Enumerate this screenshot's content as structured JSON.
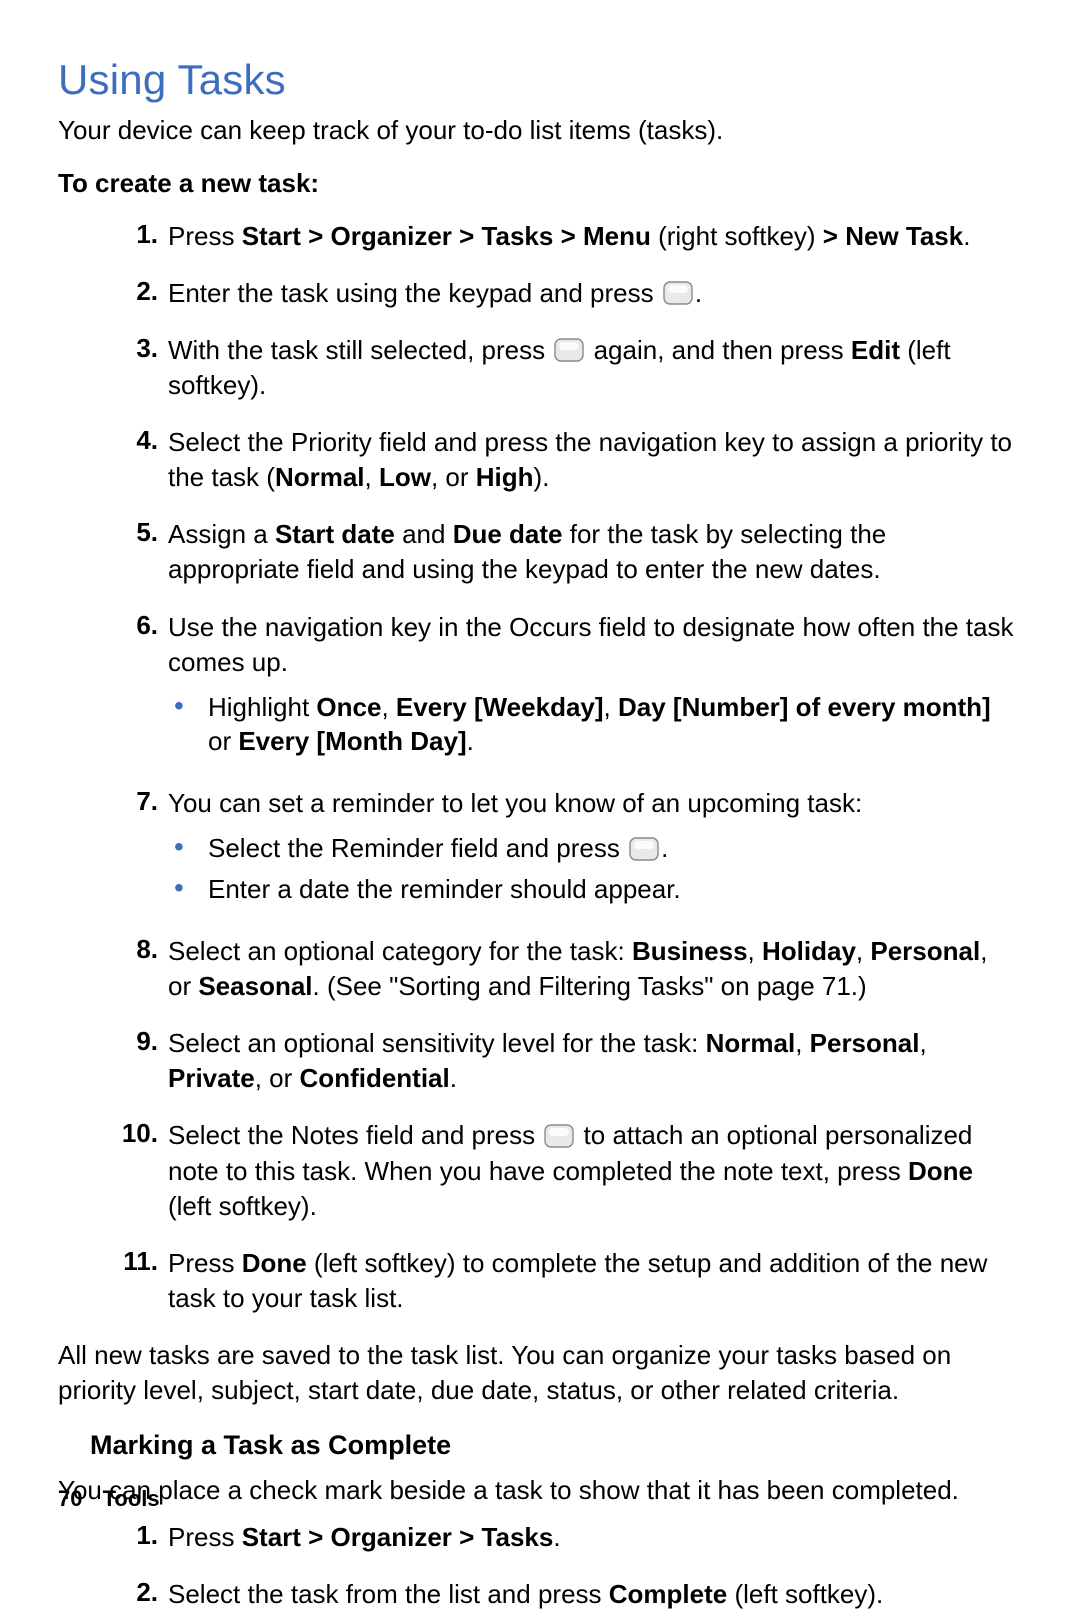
{
  "title": "Using Tasks",
  "intro": "Your device can keep track of your to-do list items (tasks).",
  "subhead_create": "To create a new task:",
  "steps": {
    "s1_a": "Press ",
    "s1_b": "Start > Organizer > Tasks > Menu",
    "s1_c": " (right softkey) ",
    "s1_d": "> New Task",
    "s1_e": ".",
    "s2_a": "Enter the task using the keypad and press ",
    "s2_b": ".",
    "s3_a": "With the task still selected, press ",
    "s3_b": " again, and then press ",
    "s3_c": "Edit",
    "s3_d": " (left softkey).",
    "s4_a": "Select the Priority field and press the navigation key to assign a priority to the task (",
    "s4_b": "Normal",
    "s4_c": ", ",
    "s4_d": "Low",
    "s4_e": ", or ",
    "s4_f": "High",
    "s4_g": ").",
    "s5_a": "Assign a ",
    "s5_b": "Start date",
    "s5_c": " and ",
    "s5_d": "Due date",
    "s5_e": " for the task by selecting the appropriate field and using the keypad to enter the new dates.",
    "s6": "Use the navigation key in the Occurs field to designate how often the task comes up.",
    "s6_sub_a": "Highlight ",
    "s6_sub_b": "Once",
    "s6_sub_c": ", ",
    "s6_sub_d": "Every [Weekday]",
    "s6_sub_e": ", ",
    "s6_sub_f": "Day [Number] of every month]",
    "s6_sub_g": " or ",
    "s6_sub_h": "Every [Month Day]",
    "s6_sub_i": ".",
    "s7": "You can set a reminder to let you know of an upcoming task:",
    "s7_sub1_a": "Select the Reminder field and press ",
    "s7_sub1_b": ".",
    "s7_sub2": "Enter a date the reminder should appear.",
    "s8_a": "Select an optional category for the task: ",
    "s8_b": "Business",
    "s8_c": ", ",
    "s8_d": "Holiday",
    "s8_e": ", ",
    "s8_f": "Personal",
    "s8_g": ", or ",
    "s8_h": "Seasonal",
    "s8_i": ". (See \"Sorting and Filtering Tasks\" on page 71.)",
    "s9_a": "Select an optional sensitivity level for the task: ",
    "s9_b": "Normal",
    "s9_c": ", ",
    "s9_d": "Personal",
    "s9_e": ", ",
    "s9_f": "Private",
    "s9_g": ", or ",
    "s9_h": "Confidential",
    "s9_i": ".",
    "s10_a": "Select the Notes field and press ",
    "s10_b": " to attach an optional personalized note to this task. When you have completed the note text, press ",
    "s10_c": "Done",
    "s10_d": " (left softkey).",
    "s11_a": "Press ",
    "s11_b": "Done",
    "s11_c": " (left softkey) to complete the setup and addition of the new task to your task list."
  },
  "after_steps": "All new tasks are saved to the task list. You can organize your tasks based on priority level, subject, start date, due date, status, or other related criteria.",
  "subhead_mark": "Marking a Task as Complete",
  "mark_intro": "You can place a check mark beside a task to show that it has been completed.",
  "mark_steps": {
    "m1_a": "Press ",
    "m1_b": "Start > Organizer > Tasks",
    "m1_c": ".",
    "m2_a": "Select the task from the list and press ",
    "m2_b": "Complete",
    "m2_c": " (left softkey)."
  },
  "footer_page": "70",
  "footer_section": "Tools",
  "nums": {
    "n1": "1.",
    "n2": "2.",
    "n3": "3.",
    "n4": "4.",
    "n5": "5.",
    "n6": "6.",
    "n7": "7.",
    "n8": "8.",
    "n9": "9.",
    "n10": "10.",
    "n11": "11."
  }
}
